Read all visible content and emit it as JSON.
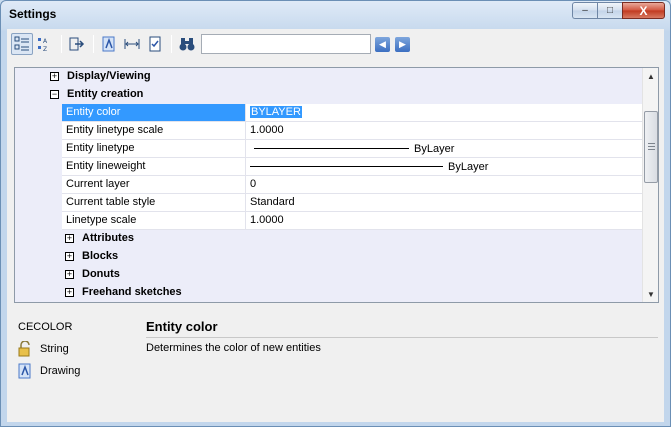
{
  "window": {
    "title": "Settings"
  },
  "titlebar_buttons": {
    "minimize": "–",
    "maximize": "□",
    "close": "X"
  },
  "toolbar": {
    "search_value": "",
    "icons": [
      "categorized-view-icon",
      "alphabetical-sort-icon",
      "export-icon",
      "drawing-icon",
      "dimension-icon",
      "checklist-icon",
      "binoculars-icon"
    ],
    "back_label": "◀",
    "forward_label": "▶"
  },
  "grid": {
    "categories_top": [
      {
        "label": "Display/Viewing",
        "expander": "+"
      },
      {
        "label": "Entity creation",
        "expander": "−"
      }
    ],
    "properties": [
      {
        "name": "Entity color",
        "value": "BYLAYER"
      },
      {
        "name": "Entity linetype scale",
        "value": "1.0000"
      },
      {
        "name": "Entity linetype",
        "value": "ByLayer"
      },
      {
        "name": "Entity lineweight",
        "value": "ByLayer"
      },
      {
        "name": "Current layer",
        "value": "0"
      },
      {
        "name": "Current table style",
        "value": "Standard"
      },
      {
        "name": "Linetype scale",
        "value": "1.0000"
      }
    ],
    "subcategories": [
      {
        "label": "Attributes",
        "expander": "+"
      },
      {
        "label": "Blocks",
        "expander": "+"
      },
      {
        "label": "Donuts",
        "expander": "+"
      },
      {
        "label": "Freehand sketches",
        "expander": "+"
      }
    ],
    "scroll_up": "▲",
    "scroll_down": "▼"
  },
  "details": {
    "command": "CECOLOR",
    "type": "String",
    "scope": "Drawing",
    "title": "Entity color",
    "description": "Determines the color of new entities"
  }
}
